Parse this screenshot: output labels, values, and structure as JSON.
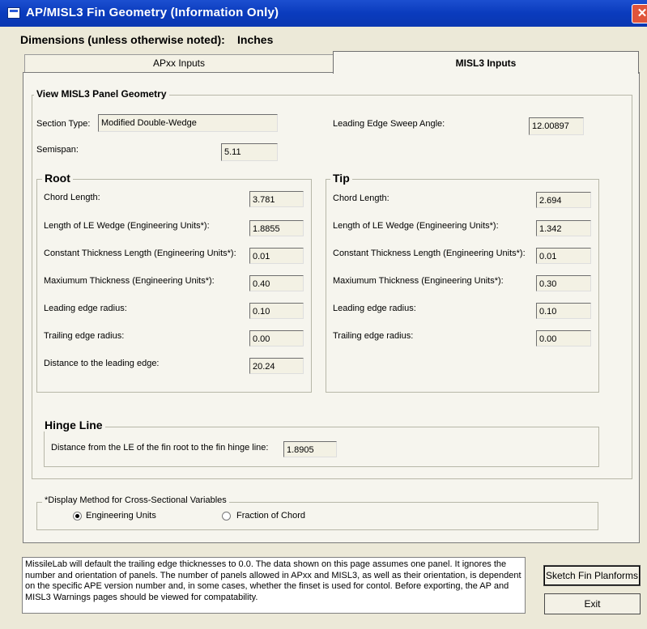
{
  "window": {
    "title": "AP/MISL3 Fin Geometry (Information Only)",
    "close_label": "✕"
  },
  "dimensions": {
    "label": "Dimensions (unless otherwise noted):",
    "unit": "Inches"
  },
  "tabs": [
    {
      "label": "APxx Inputs"
    },
    {
      "label": "MISL3 Inputs"
    }
  ],
  "panel": {
    "title": "View MISL3 Panel Geometry",
    "section_type_label": "Section Type:",
    "section_type_value": "Modified Double-Wedge",
    "le_sweep_label": "Leading Edge Sweep Angle:",
    "le_sweep_value": "12.00897",
    "semispan_label": "Semispan:",
    "semispan_value": "5.11"
  },
  "root": {
    "title": "Root",
    "rows": [
      {
        "label": "Chord Length:",
        "value": "3.781"
      },
      {
        "label": "Length of LE Wedge (Engineering Units*):",
        "value": "1.8855"
      },
      {
        "label": "Constant Thickness Length (Engineering Units*):",
        "value": "0.01"
      },
      {
        "label": "Maxiumum Thickness (Engineering Units*):",
        "value": "0.40"
      },
      {
        "label": "Leading edge radius:",
        "value": "0.10"
      },
      {
        "label": "Trailing edge radius:",
        "value": "0.00"
      },
      {
        "label": "Distance to the leading edge:",
        "value": "20.24"
      }
    ]
  },
  "tip": {
    "title": "Tip",
    "rows": [
      {
        "label": "Chord Length:",
        "value": "2.694"
      },
      {
        "label": "Length of LE Wedge (Engineering Units*):",
        "value": "1.342"
      },
      {
        "label": "Constant Thickness Length (Engineering Units*):",
        "value": "0.01"
      },
      {
        "label": "Maxiumum Thickness (Engineering Units*):",
        "value": "0.30"
      },
      {
        "label": "Leading edge radius:",
        "value": "0.10"
      },
      {
        "label": "Trailing edge radius:",
        "value": "0.00"
      }
    ]
  },
  "hinge": {
    "title": "Hinge Line",
    "label": "Distance from the LE of the fin root to the fin hinge line:",
    "value": "1.8905"
  },
  "display_method": {
    "title": "*Display Method for Cross-Sectional Variables",
    "options": [
      {
        "label": "Engineering Units",
        "selected": true
      },
      {
        "label": "Fraction of Chord",
        "selected": false
      }
    ]
  },
  "note": "MissileLab will default the trailing edge thicknesses to 0.0.  The data shown on this page assumes one panel.  It ignores the number and orientation of panels.  The number of panels allowed in APxx and MISL3, as well as their orientation, is dependent on the specific APE version number and, in some cases, whether the finset is used for contol.  Before exporting, the AP and MISL3 Warnings pages should be viewed for compatability.",
  "buttons": {
    "sketch": "Sketch Fin Planforms",
    "exit": "Exit"
  }
}
